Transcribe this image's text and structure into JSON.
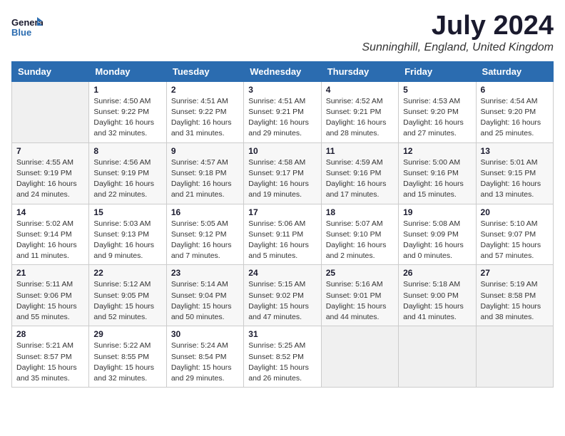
{
  "header": {
    "logo_general": "General",
    "logo_blue": "Blue",
    "month_title": "July 2024",
    "location": "Sunninghill, England, United Kingdom"
  },
  "days_of_week": [
    "Sunday",
    "Monday",
    "Tuesday",
    "Wednesday",
    "Thursday",
    "Friday",
    "Saturday"
  ],
  "weeks": [
    [
      {
        "day": "",
        "info": ""
      },
      {
        "day": "1",
        "info": "Sunrise: 4:50 AM\nSunset: 9:22 PM\nDaylight: 16 hours\nand 32 minutes."
      },
      {
        "day": "2",
        "info": "Sunrise: 4:51 AM\nSunset: 9:22 PM\nDaylight: 16 hours\nand 31 minutes."
      },
      {
        "day": "3",
        "info": "Sunrise: 4:51 AM\nSunset: 9:21 PM\nDaylight: 16 hours\nand 29 minutes."
      },
      {
        "day": "4",
        "info": "Sunrise: 4:52 AM\nSunset: 9:21 PM\nDaylight: 16 hours\nand 28 minutes."
      },
      {
        "day": "5",
        "info": "Sunrise: 4:53 AM\nSunset: 9:20 PM\nDaylight: 16 hours\nand 27 minutes."
      },
      {
        "day": "6",
        "info": "Sunrise: 4:54 AM\nSunset: 9:20 PM\nDaylight: 16 hours\nand 25 minutes."
      }
    ],
    [
      {
        "day": "7",
        "info": "Sunrise: 4:55 AM\nSunset: 9:19 PM\nDaylight: 16 hours\nand 24 minutes."
      },
      {
        "day": "8",
        "info": "Sunrise: 4:56 AM\nSunset: 9:19 PM\nDaylight: 16 hours\nand 22 minutes."
      },
      {
        "day": "9",
        "info": "Sunrise: 4:57 AM\nSunset: 9:18 PM\nDaylight: 16 hours\nand 21 minutes."
      },
      {
        "day": "10",
        "info": "Sunrise: 4:58 AM\nSunset: 9:17 PM\nDaylight: 16 hours\nand 19 minutes."
      },
      {
        "day": "11",
        "info": "Sunrise: 4:59 AM\nSunset: 9:16 PM\nDaylight: 16 hours\nand 17 minutes."
      },
      {
        "day": "12",
        "info": "Sunrise: 5:00 AM\nSunset: 9:16 PM\nDaylight: 16 hours\nand 15 minutes."
      },
      {
        "day": "13",
        "info": "Sunrise: 5:01 AM\nSunset: 9:15 PM\nDaylight: 16 hours\nand 13 minutes."
      }
    ],
    [
      {
        "day": "14",
        "info": "Sunrise: 5:02 AM\nSunset: 9:14 PM\nDaylight: 16 hours\nand 11 minutes."
      },
      {
        "day": "15",
        "info": "Sunrise: 5:03 AM\nSunset: 9:13 PM\nDaylight: 16 hours\nand 9 minutes."
      },
      {
        "day": "16",
        "info": "Sunrise: 5:05 AM\nSunset: 9:12 PM\nDaylight: 16 hours\nand 7 minutes."
      },
      {
        "day": "17",
        "info": "Sunrise: 5:06 AM\nSunset: 9:11 PM\nDaylight: 16 hours\nand 5 minutes."
      },
      {
        "day": "18",
        "info": "Sunrise: 5:07 AM\nSunset: 9:10 PM\nDaylight: 16 hours\nand 2 minutes."
      },
      {
        "day": "19",
        "info": "Sunrise: 5:08 AM\nSunset: 9:09 PM\nDaylight: 16 hours\nand 0 minutes."
      },
      {
        "day": "20",
        "info": "Sunrise: 5:10 AM\nSunset: 9:07 PM\nDaylight: 15 hours\nand 57 minutes."
      }
    ],
    [
      {
        "day": "21",
        "info": "Sunrise: 5:11 AM\nSunset: 9:06 PM\nDaylight: 15 hours\nand 55 minutes."
      },
      {
        "day": "22",
        "info": "Sunrise: 5:12 AM\nSunset: 9:05 PM\nDaylight: 15 hours\nand 52 minutes."
      },
      {
        "day": "23",
        "info": "Sunrise: 5:14 AM\nSunset: 9:04 PM\nDaylight: 15 hours\nand 50 minutes."
      },
      {
        "day": "24",
        "info": "Sunrise: 5:15 AM\nSunset: 9:02 PM\nDaylight: 15 hours\nand 47 minutes."
      },
      {
        "day": "25",
        "info": "Sunrise: 5:16 AM\nSunset: 9:01 PM\nDaylight: 15 hours\nand 44 minutes."
      },
      {
        "day": "26",
        "info": "Sunrise: 5:18 AM\nSunset: 9:00 PM\nDaylight: 15 hours\nand 41 minutes."
      },
      {
        "day": "27",
        "info": "Sunrise: 5:19 AM\nSunset: 8:58 PM\nDaylight: 15 hours\nand 38 minutes."
      }
    ],
    [
      {
        "day": "28",
        "info": "Sunrise: 5:21 AM\nSunset: 8:57 PM\nDaylight: 15 hours\nand 35 minutes."
      },
      {
        "day": "29",
        "info": "Sunrise: 5:22 AM\nSunset: 8:55 PM\nDaylight: 15 hours\nand 32 minutes."
      },
      {
        "day": "30",
        "info": "Sunrise: 5:24 AM\nSunset: 8:54 PM\nDaylight: 15 hours\nand 29 minutes."
      },
      {
        "day": "31",
        "info": "Sunrise: 5:25 AM\nSunset: 8:52 PM\nDaylight: 15 hours\nand 26 minutes."
      },
      {
        "day": "",
        "info": ""
      },
      {
        "day": "",
        "info": ""
      },
      {
        "day": "",
        "info": ""
      }
    ]
  ]
}
